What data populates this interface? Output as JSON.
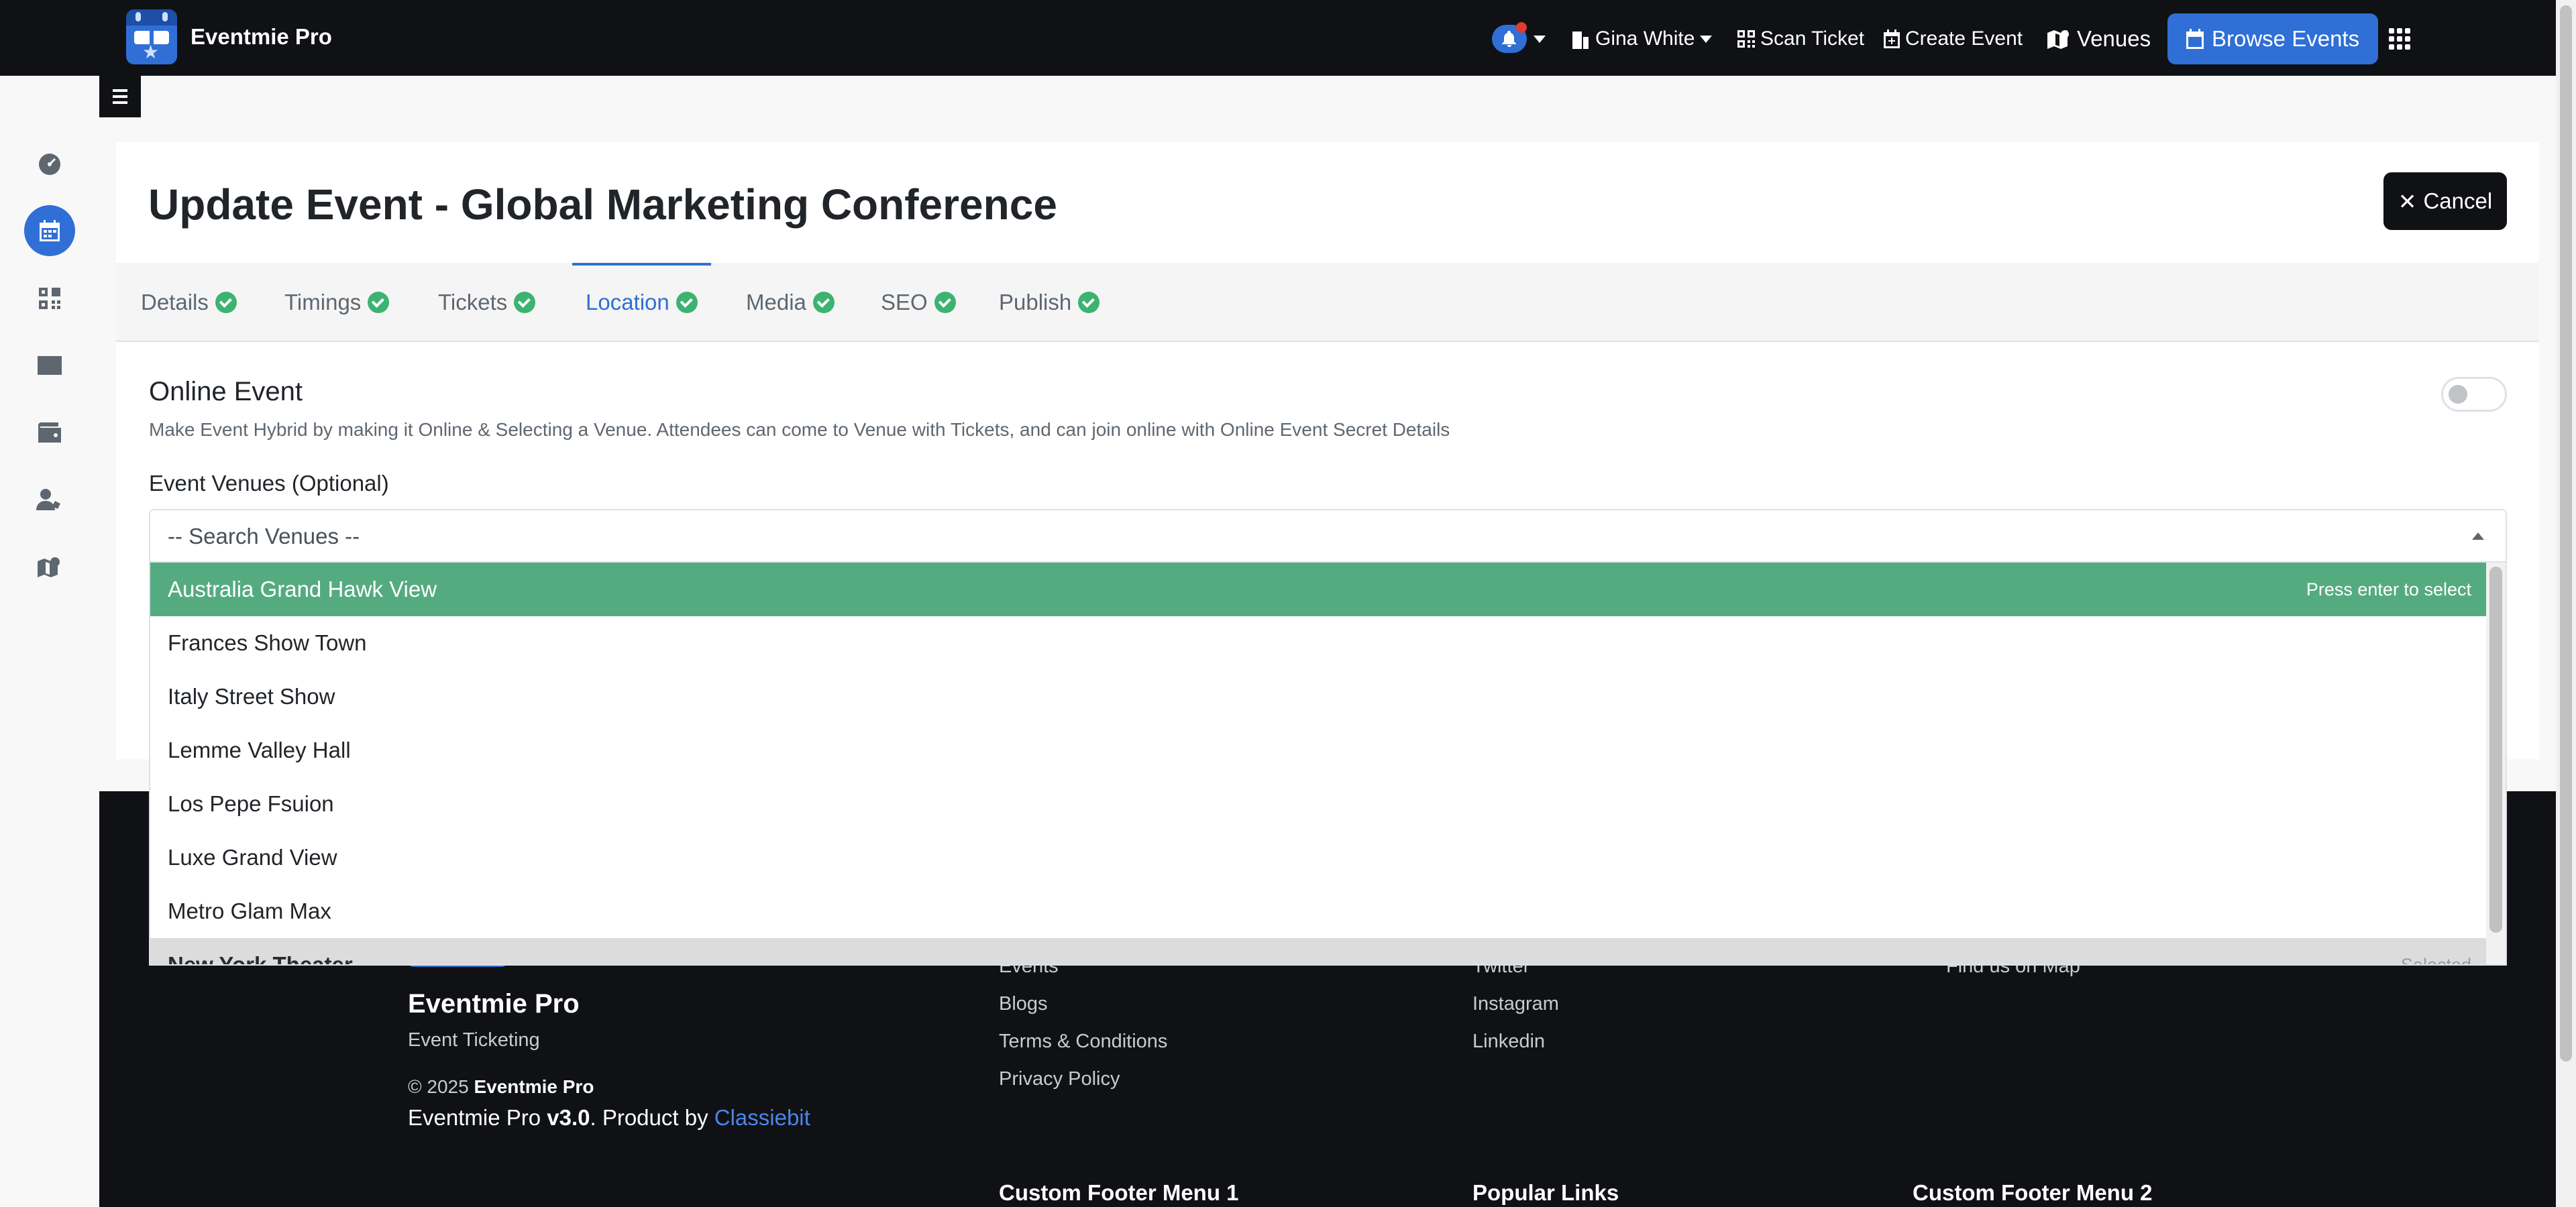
{
  "navbar": {
    "brand": "Eventmie Pro",
    "user": "Gina White",
    "scan_ticket": "Scan Ticket",
    "create_event": "Create Event",
    "venues": "Venues",
    "browse_events": "Browse Events"
  },
  "page": {
    "title": "Update Event - Global Marketing Conference",
    "cancel": "Cancel"
  },
  "tabs": [
    "Details",
    "Timings",
    "Tickets",
    "Location",
    "Media",
    "SEO",
    "Publish"
  ],
  "active_tab": "Location",
  "location": {
    "online_title": "Online Event",
    "online_desc": "Make Event Hybrid by making it Online & Selecting a Venue. Attendees can come to Venue with Tickets, and can join online with Online Event Secret Details",
    "venues_label": "Event Venues (Optional)",
    "search_placeholder": "-- Search Venues --",
    "options": [
      "Australia Grand Hawk View",
      "Frances Show Town",
      "Italy Street Show",
      "Lemme Valley Hall",
      "Los Pepe Fsuion",
      "Luxe Grand View",
      "Metro Glam Max",
      "New York Theater"
    ],
    "highlight_hint": "Press enter to select",
    "selected_hint": "Selected"
  },
  "footer": {
    "brand": "Eventmie Pro",
    "tagline": "Event Ticketing",
    "copyright_prefix": "© 2025 ",
    "copyright_brand": "Eventmie Pro",
    "version_prefix": "Eventmie Pro ",
    "version": "v3.0",
    "product_by": ". Product by ",
    "company": "Classiebit",
    "col1": [
      "Events",
      "Blogs",
      "Terms & Conditions",
      "Privacy Policy"
    ],
    "col2": [
      "Twitter",
      "Instagram",
      "Linkedin"
    ],
    "col3": [
      "Find us on Map"
    ],
    "menu1": "Custom Footer Menu 1",
    "menu2": "Popular Links",
    "menu3": "Custom Footer Menu 2"
  },
  "colors": {
    "navbar": "#101114",
    "accent": "#2f6fd6",
    "success": "#3cb371",
    "highlight": "#55ab80"
  }
}
